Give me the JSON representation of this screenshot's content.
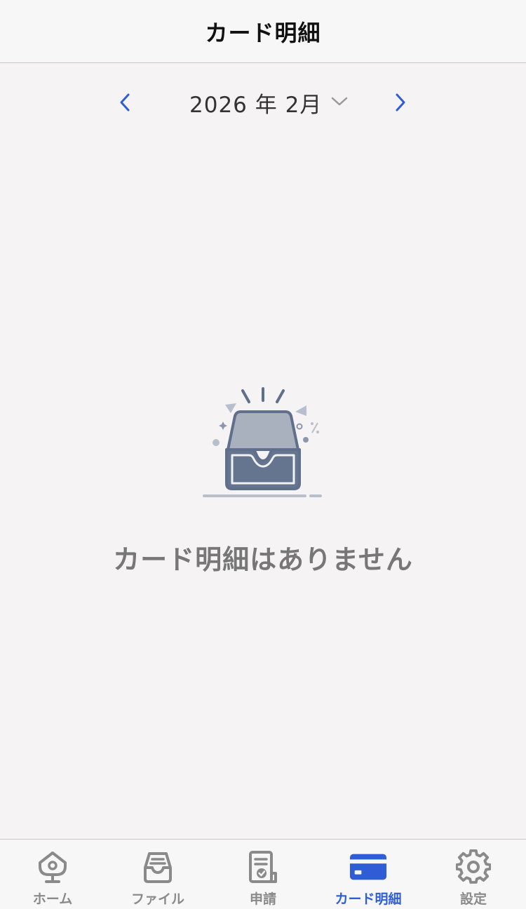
{
  "header": {
    "title": "カード明細"
  },
  "month_nav": {
    "current": "2026 年 2月",
    "prev_icon": "chevron-left-icon",
    "next_icon": "chevron-right-icon",
    "dropdown_icon": "chevron-down-icon"
  },
  "empty_state": {
    "message": "カード明細はありません",
    "icon": "empty-inbox-icon"
  },
  "tabbar": {
    "items": [
      {
        "label": "ホーム",
        "icon": "home-icon",
        "active": false
      },
      {
        "label": "ファイル",
        "icon": "inbox-icon",
        "active": false
      },
      {
        "label": "申請",
        "icon": "application-document-icon",
        "active": false
      },
      {
        "label": "カード明細",
        "icon": "credit-card-icon",
        "active": true
      },
      {
        "label": "設定",
        "icon": "gear-icon",
        "active": false
      }
    ]
  },
  "colors": {
    "accent": "#2f5dd6",
    "inactive": "#8a8a8a",
    "background": "#f5f3f4"
  }
}
